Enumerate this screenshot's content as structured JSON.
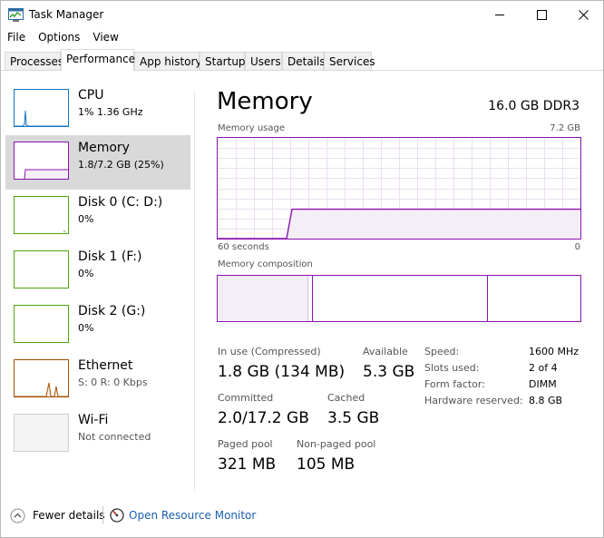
{
  "window": {
    "title": "Task Manager"
  },
  "menu": [
    {
      "label": "File"
    },
    {
      "label": "Options"
    },
    {
      "label": "View"
    }
  ],
  "tabs": [
    {
      "label": "Processes"
    },
    {
      "label": "Performance"
    },
    {
      "label": "App history"
    },
    {
      "label": "Startup"
    },
    {
      "label": "Users"
    },
    {
      "label": "Details"
    },
    {
      "label": "Services"
    }
  ],
  "active_tab": "Performance",
  "resources": [
    {
      "name": "CPU",
      "sub": "1%  1.36 GHz"
    },
    {
      "name": "Memory",
      "sub": "1.8/7.2 GB (25%)"
    },
    {
      "name": "Disk 0 (C: D:)",
      "sub": "0%"
    },
    {
      "name": "Disk 1 (F:)",
      "sub": "0%"
    },
    {
      "name": "Disk 2 (G:)",
      "sub": "0%"
    },
    {
      "name": "Ethernet",
      "sub": "S: 0  R: 0 Kbps"
    },
    {
      "name": "Wi-Fi",
      "sub": "Not connected"
    }
  ],
  "memory": {
    "title": "Memory",
    "spec": "16.0 GB DDR3",
    "usage_label": "Memory usage",
    "usage_max": "7.2 GB",
    "time_label": "60 seconds",
    "time_end": "0",
    "usage_fraction": 0.25,
    "composition_label": "Memory composition",
    "in_use_fraction": 0.25,
    "stats": {
      "in_use_label": "In use (Compressed)",
      "in_use_value": "1.8 GB (134 MB)",
      "available_label": "Available",
      "available_value": "5.3 GB",
      "committed_label": "Committed",
      "committed_value": "2.0/17.2 GB",
      "cached_label": "Cached",
      "cached_value": "3.5 GB",
      "paged_label": "Paged pool",
      "paged_value": "321 MB",
      "nonpaged_label": "Non-paged pool",
      "nonpaged_value": "105 MB"
    },
    "specs": [
      {
        "label": "Speed:",
        "value": "1600 MHz"
      },
      {
        "label": "Slots used:",
        "value": "2 of 4"
      },
      {
        "label": "Form factor:",
        "value": "DIMM"
      },
      {
        "label": "Hardware reserved:",
        "value": "8.8 GB"
      }
    ]
  },
  "footer": {
    "fewer_details": "Fewer details",
    "open_monitor": "Open Resource Monitor"
  },
  "colors": {
    "memory": "#8b12ae",
    "cpu": "#1174c3",
    "disk": "#4da60c",
    "ethernet": "#a74f01",
    "link": "#1a5fb4"
  }
}
